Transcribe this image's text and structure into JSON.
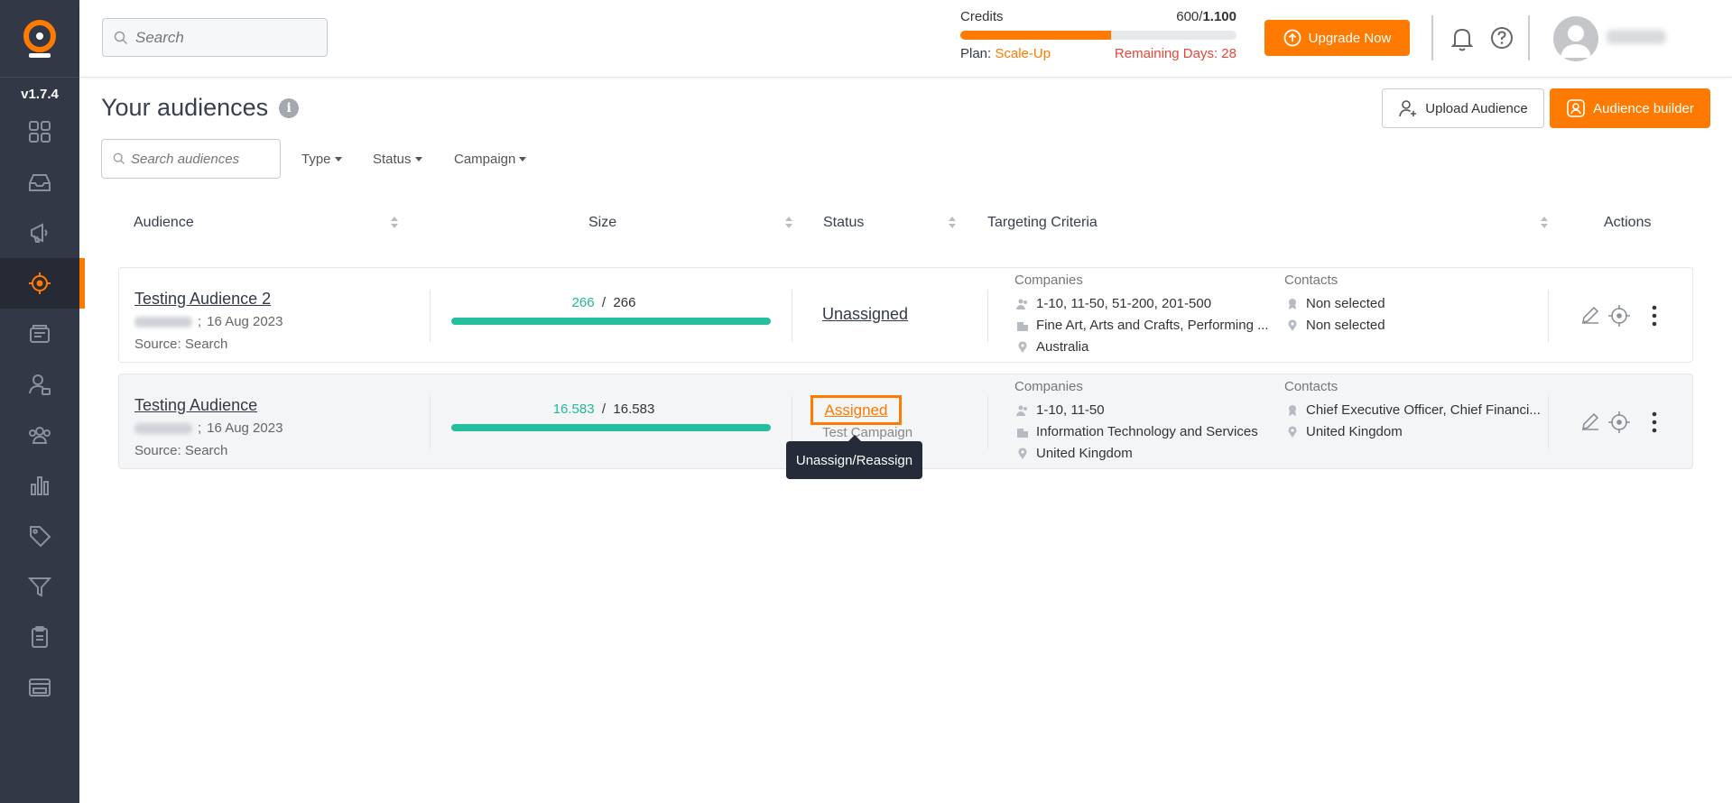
{
  "app": {
    "version": "v1.7.4"
  },
  "sidebar": {
    "items": [
      {
        "icon": "dashboard-grid-icon"
      },
      {
        "icon": "inbox-icon"
      },
      {
        "icon": "campaign-megaphone-icon"
      },
      {
        "icon": "target-icon",
        "active": true
      },
      {
        "icon": "companies-stack-icon"
      },
      {
        "icon": "contact-person-icon"
      },
      {
        "icon": "team-users-icon"
      },
      {
        "icon": "analytics-bars-icon"
      },
      {
        "icon": "tag-icon"
      },
      {
        "icon": "funnel-icon"
      },
      {
        "icon": "clipboard-icon"
      },
      {
        "icon": "crm-window-icon"
      }
    ]
  },
  "header": {
    "search_placeholder": "Search",
    "credits": {
      "label": "Credits",
      "used": "600",
      "total": "1.100",
      "fill_fraction": 0.5454,
      "plan_label": "Plan:",
      "plan_value": "Scale-Up",
      "remaining": "Remaining Days: 28"
    },
    "upgrade_label": "Upgrade Now"
  },
  "page": {
    "title": "Your audiences",
    "upload_label": "Upload Audience",
    "builder_label": "Audience builder",
    "search_placeholder": "Search audiences",
    "filters": [
      "Type",
      "Status",
      "Campaign"
    ]
  },
  "table": {
    "headers": {
      "audience": "Audience",
      "size": "Size",
      "status": "Status",
      "targeting": "Targeting Criteria",
      "actions": "Actions"
    },
    "rows": [
      {
        "name": "Testing Audience 2",
        "date": "16 Aug 2023",
        "source": "Source: Search",
        "size_found": "266",
        "size_total": "266",
        "size_fraction": 1.0,
        "status": "Unassigned",
        "campaign": "",
        "companies_label": "Companies",
        "companies": [
          "1-10, 11-50, 51-200, 201-500",
          "Fine Art, Arts and Crafts, Performing ...",
          "Australia"
        ],
        "contacts_label": "Contacts",
        "contacts": [
          "Non selected",
          "Non selected"
        ]
      },
      {
        "name": "Testing Audience",
        "date": "16 Aug 2023",
        "source": "Source: Search",
        "size_found": "16.583",
        "size_total": "16.583",
        "size_fraction": 1.0,
        "status": "Assigned",
        "campaign": "Test Campaign",
        "companies_label": "Companies",
        "companies": [
          "1-10, 11-50",
          "Information Technology and Services",
          "United Kingdom"
        ],
        "contacts_label": "Contacts",
        "contacts": [
          "Chief Executive Officer, Chief Financi...",
          "United Kingdom"
        ]
      }
    ]
  },
  "tooltip": {
    "text": "Unassign/Reassign"
  },
  "colors": {
    "accent": "#ff7a00",
    "success": "#25bfa0",
    "danger": "#e8453c",
    "sidebar": "#323845"
  }
}
